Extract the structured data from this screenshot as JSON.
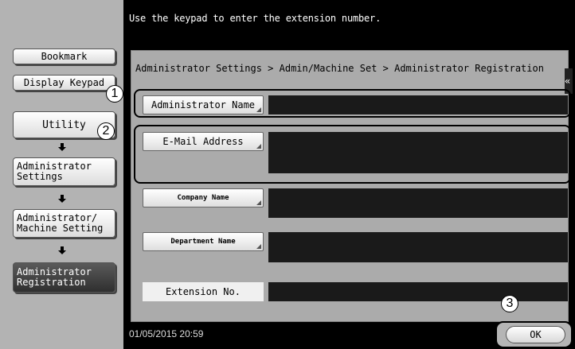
{
  "sidebar": {
    "bookmark_label": "Bookmark",
    "display_keypad_label": "Display Keypad",
    "utility_label": "Utility",
    "admin_settings_label": "Administrator Settings",
    "admin_machine_label": "Administrator/ Machine Setting",
    "admin_registration_label": "Administrator Registration"
  },
  "header": {
    "hint": "Use the keypad to enter the extension number."
  },
  "breadcrumb": "Administrator Settings > Admin/Machine Set > Administrator Registration",
  "fields": {
    "administrator_name_label": "Administrator Name",
    "email_label": "E-Mail Address",
    "company_name_label": "Company Name",
    "department_name_label": "Department Name",
    "extension_label": "Extension No."
  },
  "callouts": {
    "one": "1",
    "two": "2",
    "three": "3"
  },
  "footer": {
    "datetime": "01/05/2015  20:59",
    "ok_label": "OK"
  },
  "colors": {
    "screen_bg": "#000000",
    "panel_bg": "#ababab",
    "sidebar_bg": "#b3b3b3"
  }
}
